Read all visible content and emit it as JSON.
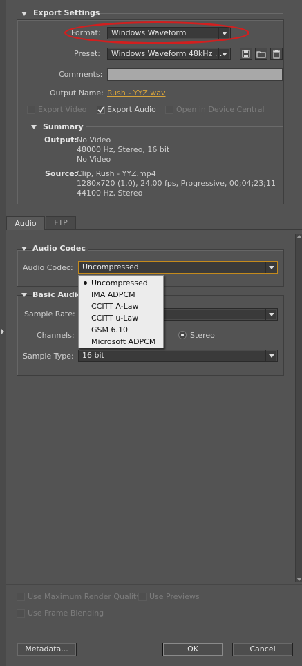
{
  "export_settings": {
    "title": "Export Settings",
    "format_label": "Format:",
    "format_value": "Windows Waveform",
    "preset_label": "Preset:",
    "preset_value": "Windows Waveform 48kHz ...",
    "comments_label": "Comments:",
    "comments_value": "",
    "output_name_label": "Output Name:",
    "output_name_value": "Rush - YYZ.wav",
    "export_video_label": "Export Video",
    "export_audio_label": "Export Audio",
    "device_central_label": "Open in Device Central"
  },
  "summary": {
    "title": "Summary",
    "output_label": "Output:",
    "output_lines": [
      "No Video",
      "48000 Hz, Stereo, 16 bit",
      "No Video"
    ],
    "source_label": "Source:",
    "source_lines": [
      "Clip, Rush - YYZ.mp4",
      "1280x720 (1.0), 24.00 fps, Progressive, 00;04;23;11",
      "44100 Hz, Stereo"
    ]
  },
  "tabs": [
    "Audio",
    "FTP"
  ],
  "audio_codec": {
    "title": "Audio Codec",
    "label": "Audio Codec:",
    "value": "Uncompressed",
    "options": [
      "Uncompressed",
      "IMA ADPCM",
      "CCITT A-Law",
      "CCITT u-Law",
      "GSM 6.10",
      "Microsoft ADPCM"
    ]
  },
  "basic_audio": {
    "title": "Basic Audio",
    "sample_rate_label": "Sample Rate:",
    "channels_label": "Channels:",
    "channels_value": "Stereo",
    "sample_type_label": "Sample Type:",
    "sample_type_value": "16 bit"
  },
  "bottom": {
    "max_render_label": "Use Maximum Render Quality",
    "previews_label": "Use Previews",
    "frame_blending_label": "Use Frame Blending",
    "metadata_button": "Metadata...",
    "ok_button": "OK",
    "cancel_button": "Cancel"
  }
}
